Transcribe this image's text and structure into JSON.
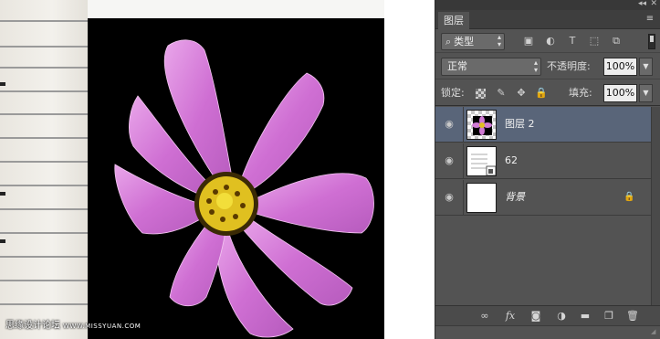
{
  "canvas": {
    "watermark_text": "思缘设计论坛",
    "watermark_site": "WWW.MISSYUAN.COM"
  },
  "panel": {
    "tab_label": "图层",
    "filter": {
      "lead_icon": "search-icon",
      "kind_label": "类型"
    },
    "blend_mode": "正常",
    "opacity_label": "不透明度:",
    "opacity_value": "100%",
    "lock_label": "锁定:",
    "fill_label": "填充:",
    "fill_value": "100%",
    "layers": [
      {
        "name": "图层 2",
        "selected": true,
        "visible": true,
        "thumbnail": "flower-on-transparent"
      },
      {
        "name": "62",
        "selected": false,
        "visible": true,
        "thumbnail": "smart-object"
      },
      {
        "name": "背景",
        "selected": false,
        "visible": true,
        "locked": true,
        "thumbnail": "white"
      }
    ],
    "bottom_icons": [
      "link-layers-icon",
      "fx-icon",
      "layer-mask-icon",
      "adjustment-layer-icon",
      "new-group-icon",
      "new-layer-icon",
      "delete-layer-icon"
    ],
    "fx_label": "fx"
  },
  "colors": {
    "panel_bg": "#535353",
    "selected_layer": "#596579",
    "flower_petal": "#d07ad4",
    "flower_center": "#e0c020"
  }
}
